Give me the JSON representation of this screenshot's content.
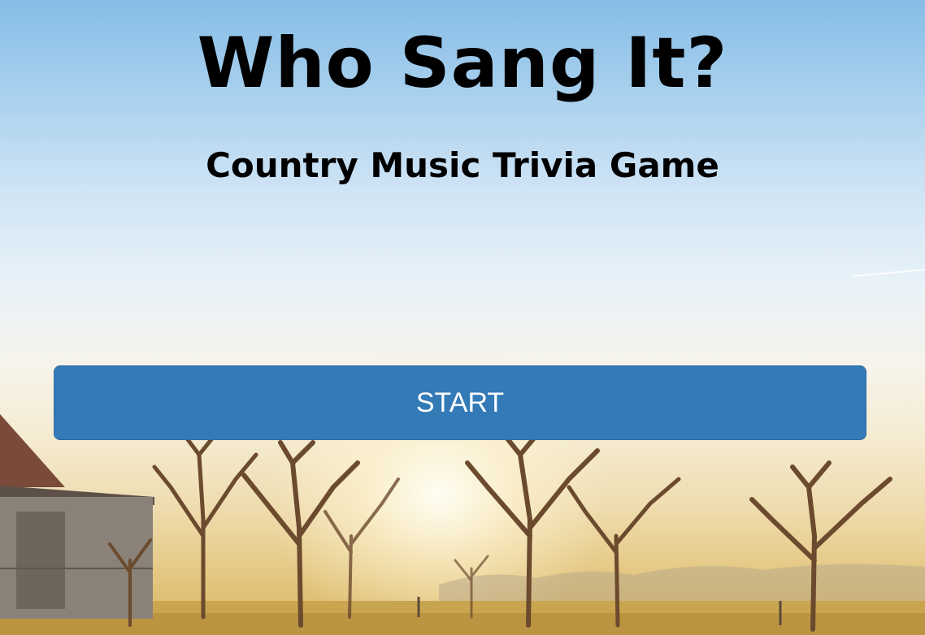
{
  "game": {
    "title": "Who Sang It?",
    "subtitle": "Country Music Trivia Game"
  },
  "actions": {
    "start_label": "START"
  },
  "colors": {
    "button_bg": "#337ab7",
    "button_text": "#ffffff",
    "title_text": "#000000"
  },
  "background": {
    "scene": "sunrise-countryside-with-barn-and-trees"
  }
}
